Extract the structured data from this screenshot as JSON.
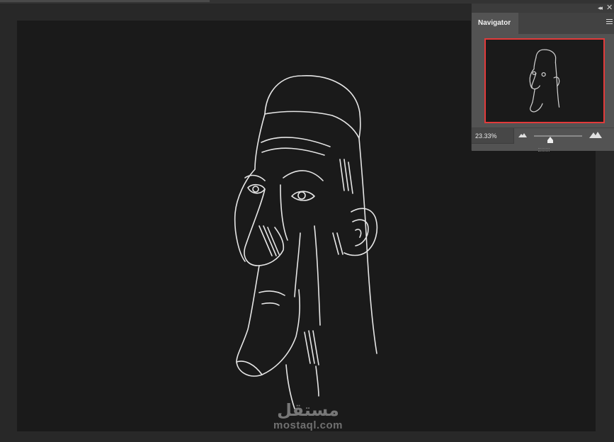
{
  "navigator": {
    "tab_label": "Navigator",
    "zoom_value": "23.33%",
    "zoom_slider_fraction": 0.34
  },
  "icons": {
    "collapse": "double-chevron-icon",
    "close": "close-icon",
    "menu": "panel-menu-icon",
    "zoom_out": "small-mountain-icon",
    "zoom_in": "large-mountain-icon"
  },
  "watermark": {
    "arabic": "مستقل",
    "latin": "mostaql.com"
  },
  "colors": {
    "canvas": "#1a1a1a",
    "workspace": "#282828",
    "panel": "#535353",
    "view_box": "#e23a3a",
    "drawing_stroke": "#e6e6e6"
  }
}
